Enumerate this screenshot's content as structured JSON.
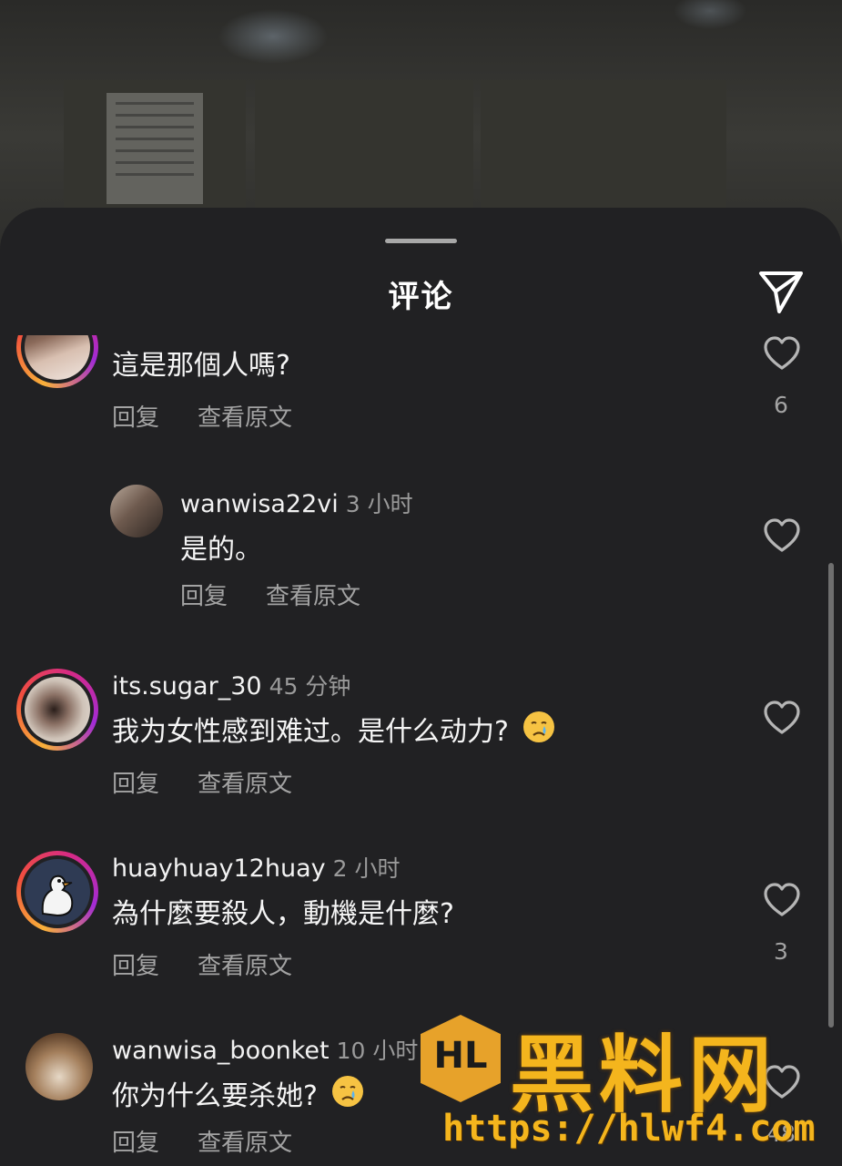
{
  "header": {
    "title": "评论"
  },
  "comments": [
    {
      "username": "",
      "time": "",
      "text": "這是那個人嗎?",
      "reply_label": "回复",
      "translate_label": "查看原文",
      "likes": "6"
    },
    {
      "username": "wanwisa22vi",
      "time": "3 小时",
      "text": "是的。",
      "reply_label": "回复",
      "translate_label": "查看原文",
      "likes": ""
    },
    {
      "username": "its.sugar_30",
      "time": "45 分钟",
      "text": "我为女性感到难过。是什么动力?",
      "reply_label": "回复",
      "translate_label": "查看原文",
      "likes": ""
    },
    {
      "username": "huayhuay12huay",
      "time": "2 小时",
      "text": "為什麼要殺人，動機是什麼?",
      "reply_label": "回复",
      "translate_label": "查看原文",
      "likes": "3"
    },
    {
      "username": "wanwisa_boonket",
      "time": "10 小时",
      "text": "你为什么要杀她?",
      "reply_label": "回复",
      "translate_label": "查看原文",
      "likes": "48"
    }
  ],
  "icons": {
    "send": "paper-plane-icon",
    "like": "heart-outline-icon",
    "crying_emoji": "crying-face-emoji"
  },
  "watermark": {
    "logo_text": "HL",
    "title": "黑料网",
    "url": "https://hlwf4.com"
  },
  "colors": {
    "sheet_bg": "#212123",
    "watermark": "#f4b51d",
    "secondary_text": "#a3a3a3"
  }
}
